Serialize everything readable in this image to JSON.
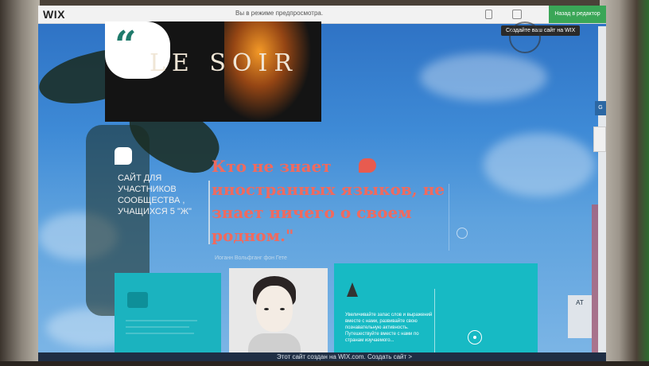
{
  "topbar": {
    "logo": "WIX",
    "preview_text": "Вы в режиме предпросмотра.",
    "editor_button": "Назад в редактор",
    "create_tip": "Создайте ваш сайт на WIX"
  },
  "header": {
    "brand": "LE SOIR",
    "quote_mark": "“"
  },
  "sidebar": {
    "description": "САЙТ ДЛЯ УЧАСТНИКОВ СООБЩЕСТВА , УЧАЩИХСЯ 5 \"Ж\""
  },
  "quote": {
    "text": "Кто не знает иностранных языков, не знает ничего о своем родном.\"",
    "author": "Иоганн Вольфганг фон Гете"
  },
  "blocks": {
    "teal_text": "Увеличивайте запас слов и выражений вместе с нами, развивайте свою познавательную активность. Путешествуйте вместе с нами по странам изучаемого..."
  },
  "footer": {
    "text": "Этот сайт создан на WIX.com. Создать сайт >"
  },
  "widgets": {
    "right_widget": "G",
    "chat_label": "AT"
  },
  "colors": {
    "accent_red": "#f06a5e",
    "teal": "#1bb3bf",
    "wix_green": "#3aa657"
  }
}
